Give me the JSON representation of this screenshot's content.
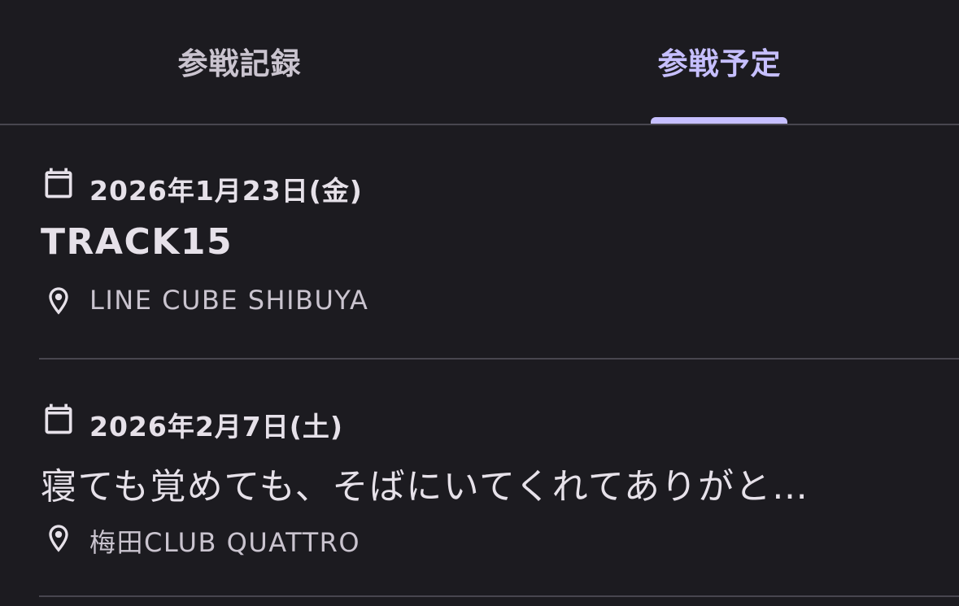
{
  "tabs": {
    "record": "参戦記録",
    "planned": "参戦予定",
    "active": "planned"
  },
  "events": [
    {
      "date": "2026年1月23日(金)",
      "title": "TRACK15",
      "venue": "LINE CUBE SHIBUYA"
    },
    {
      "date": "2026年2月7日(土)",
      "title": "寝ても覚めても、そばにいてくれてありがと…",
      "venue": "梅田CLUB QUATTRO"
    }
  ],
  "colors": {
    "background": "#1c1b20",
    "accent": "#c6bfff",
    "divider": "#48464f",
    "text_primary": "#e6e1e9",
    "text_secondary": "#cac4cf"
  },
  "icons": {
    "date": "calendar-icon",
    "venue": "location-pin-icon"
  }
}
